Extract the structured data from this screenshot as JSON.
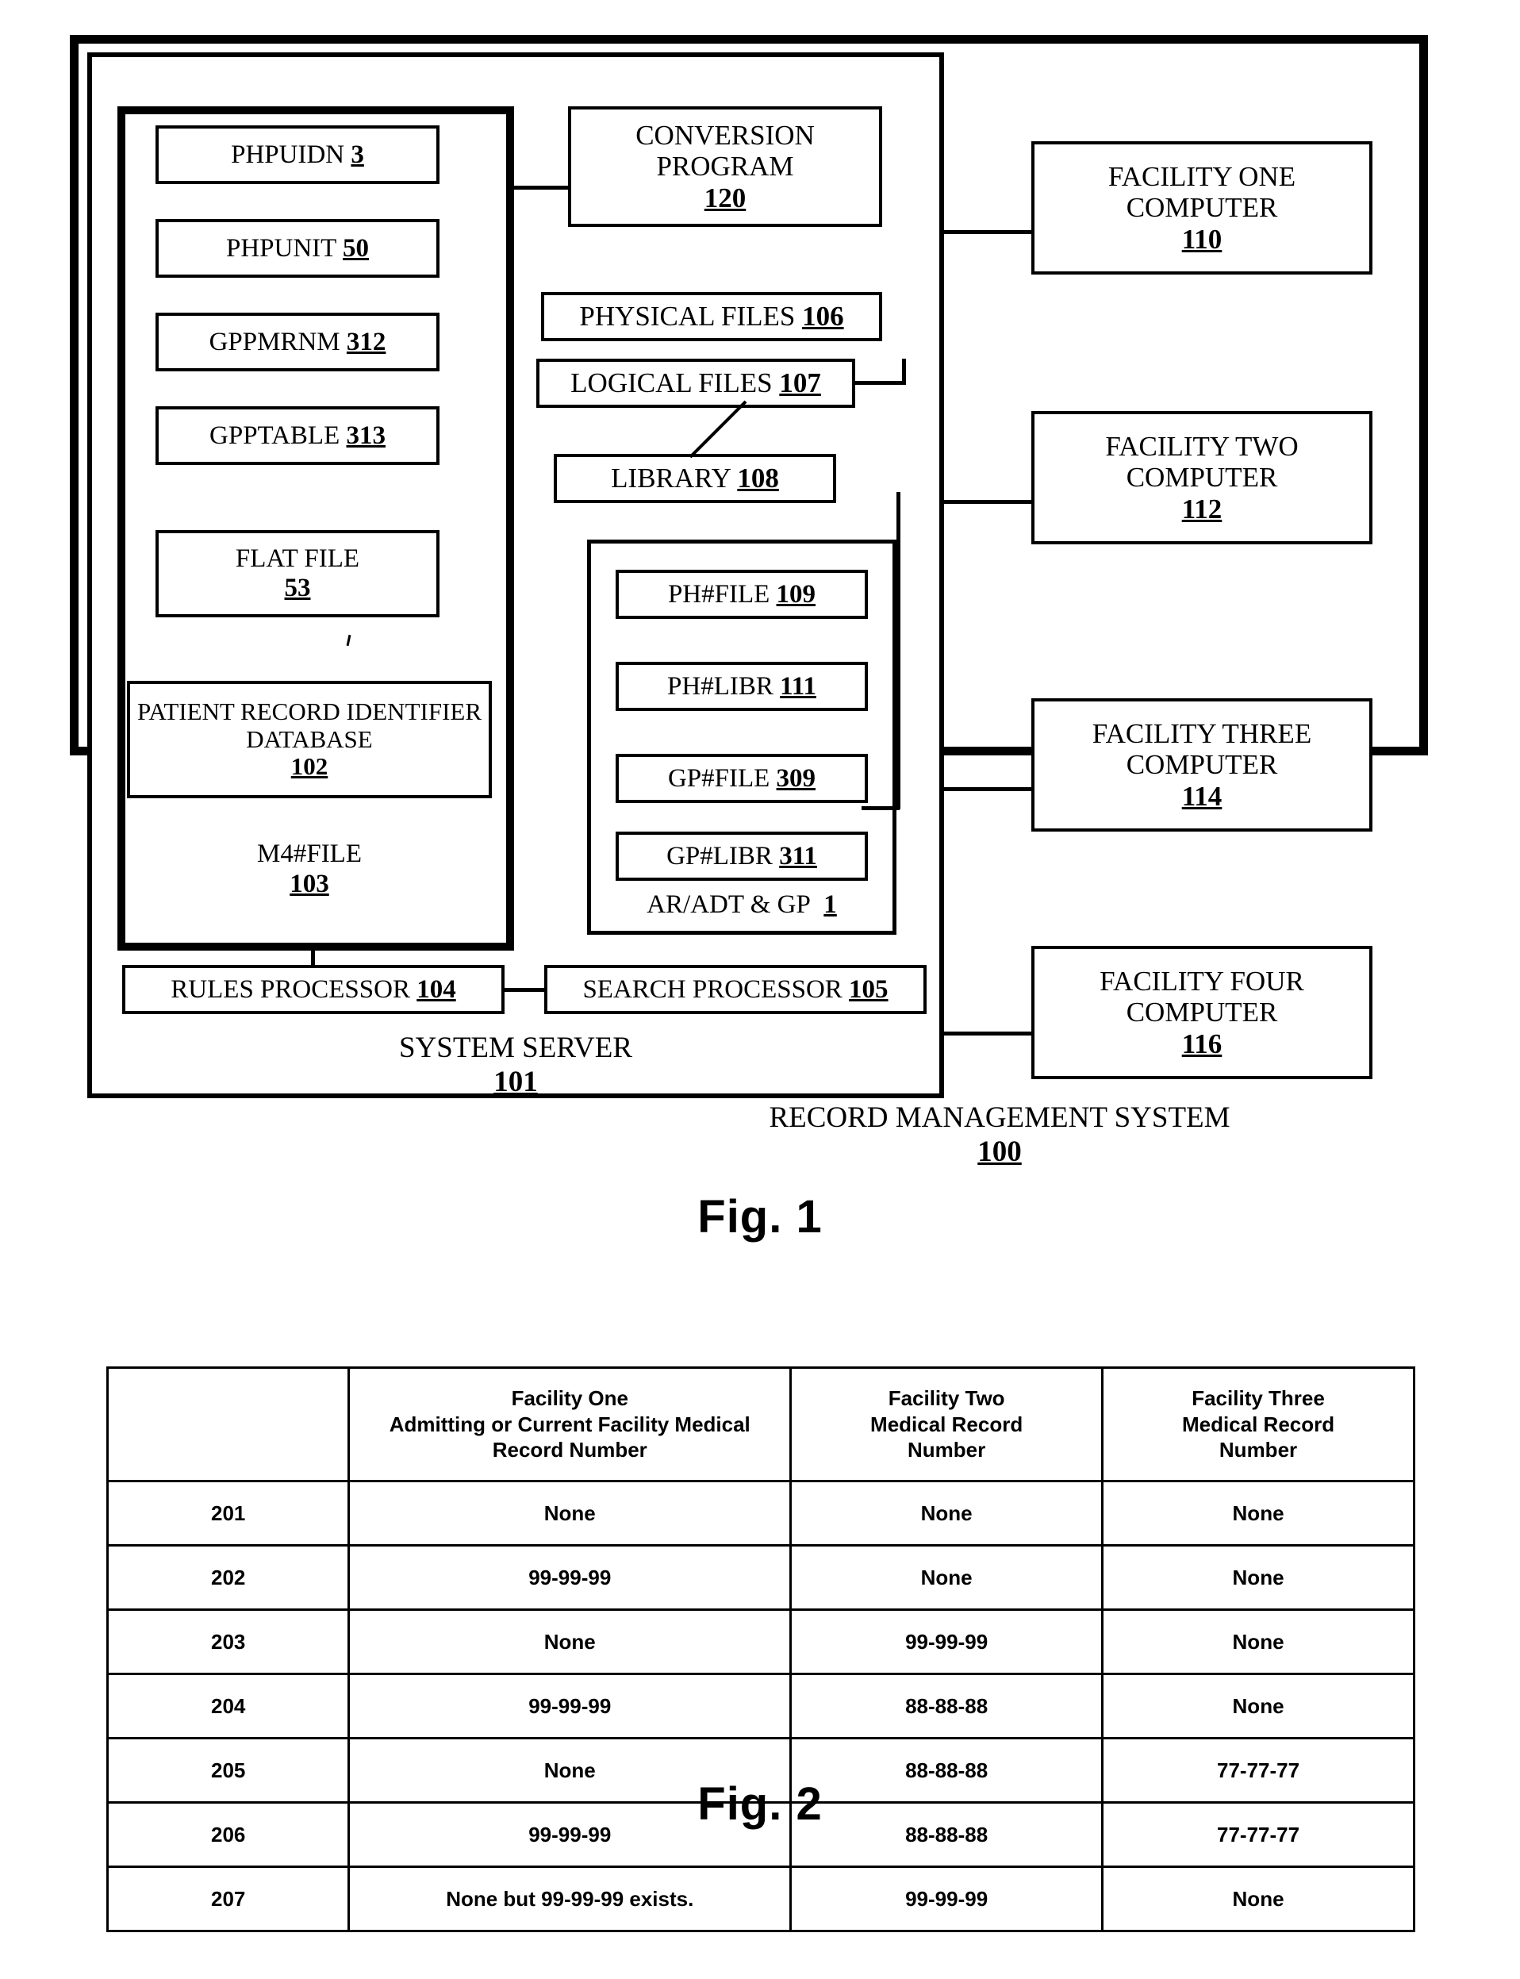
{
  "figure1": {
    "caption": "Fig.  1",
    "record_management_system": {
      "label": "RECORD MANAGEMENT SYSTEM",
      "ref": "100"
    },
    "system_server": {
      "label": "SYSTEM SERVER",
      "ref": "101"
    },
    "patient_record_group": {
      "outer_label": "M4#FILE",
      "outer_ref": "103"
    },
    "ar_adt_gp_group": {
      "label": "AR/ADT & GP",
      "ref": "1"
    },
    "left_column": [
      {
        "name": "PHPUIDN",
        "ref": "3"
      },
      {
        "name": "PHPUNIT",
        "ref": "50"
      },
      {
        "name": "GPPMRNM",
        "ref": "312"
      },
      {
        "name": "GPPTABLE",
        "ref": "313"
      },
      {
        "name": "FLAT FILE",
        "ref": "53",
        "two_line": true
      },
      {
        "name": "PATIENT RECORD IDENTIFIER DATABASE",
        "ref": "102",
        "two_line": true
      }
    ],
    "middle_column": [
      {
        "name": "CONVERSION PROGRAM",
        "ref": "120"
      },
      {
        "name": "PHYSICAL FILES",
        "ref": "106"
      },
      {
        "name": "LOGICAL FILES",
        "ref": "107"
      },
      {
        "name": "LIBRARY",
        "ref": "108"
      }
    ],
    "ar_adt_boxes": [
      {
        "name": "PH#FILE",
        "ref": "109"
      },
      {
        "name": "PH#LIBR",
        "ref": "111"
      },
      {
        "name": "GP#FILE",
        "ref": "309"
      },
      {
        "name": "GP#LIBR",
        "ref": "311"
      }
    ],
    "processors": [
      {
        "name": "RULES PROCESSOR",
        "ref": "104"
      },
      {
        "name": "SEARCH PROCESSOR",
        "ref": "105"
      }
    ],
    "facilities": [
      {
        "line1": "FACILITY ONE",
        "line2": "COMPUTER",
        "ref": "110"
      },
      {
        "line1": "FACILITY TWO",
        "line2": "COMPUTER",
        "ref": "112"
      },
      {
        "line1": "FACILITY THREE",
        "line2": "COMPUTER",
        "ref": "114"
      },
      {
        "line1": "FACILITY FOUR",
        "line2": "COMPUTER",
        "ref": "116"
      }
    ]
  },
  "figure2": {
    "caption": "Fig.  2",
    "headers": [
      "",
      "Facility One\nAdmitting or Current Facility Medical\nRecord Number",
      "Facility Two\nMedical Record\nNumber",
      "Facility Three\nMedical Record\nNumber"
    ],
    "header_lines": {
      "h1": [
        "Facility One",
        "Admitting or Current Facility Medical",
        "Record Number"
      ],
      "h2": [
        "Facility Two",
        "Medical Record",
        "Number"
      ],
      "h3": [
        "Facility Three",
        "Medical Record",
        "Number"
      ]
    },
    "rows": [
      {
        "id": "201",
        "f1": "None",
        "f2": "None",
        "f3": "None"
      },
      {
        "id": "202",
        "f1": "99-99-99",
        "f2": "None",
        "f3": "None"
      },
      {
        "id": "203",
        "f1": "None",
        "f2": "99-99-99",
        "f3": "None"
      },
      {
        "id": "204",
        "f1": "99-99-99",
        "f2": "88-88-88",
        "f3": "None"
      },
      {
        "id": "205",
        "f1": "None",
        "f2": "88-88-88",
        "f3": "77-77-77"
      },
      {
        "id": "206",
        "f1": "99-99-99",
        "f2": "88-88-88",
        "f3": "77-77-77"
      },
      {
        "id": "207",
        "f1": "None but 99-99-99 exists.",
        "f2": "99-99-99",
        "f3": "None"
      }
    ]
  },
  "colors": {
    "ink": "#000000",
    "paper": "#ffffff"
  }
}
